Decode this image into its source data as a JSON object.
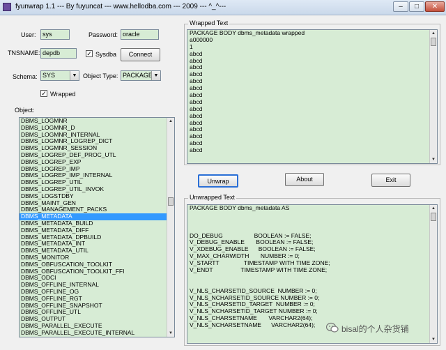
{
  "window": {
    "title": "fyunwrap 1.1 --- By fuyuncat --- www.hellodba.com --- 2009 --- ^_^---",
    "minimize": "–",
    "maximize": "□",
    "close": "✕"
  },
  "form": {
    "user_label": "User:",
    "user_value": "sys",
    "password_label": "Password:",
    "password_value": "oracle",
    "tnsname_label": "TNSNAME:",
    "tnsname_value": "depdb",
    "sysdba_label": "Sysdba",
    "sysdba_checked": "✓",
    "connect_label": "Connect",
    "schema_label": "Schema:",
    "schema_value": "SYS",
    "object_type_label": "Object Type:",
    "object_type_value": "PACKAGE B",
    "wrapped_label": "Wrapped",
    "wrapped_checked": "✓",
    "object_label": "Object:"
  },
  "objects": [
    "DBMS_LOGMNR",
    "DBMS_LOGMNR_D",
    "DBMS_LOGMNR_INTERNAL",
    "DBMS_LOGMNR_LOGREP_DICT",
    "DBMS_LOGMNR_SESSION",
    "DBMS_LOGREP_DEF_PROC_UTL",
    "DBMS_LOGREP_EXP",
    "DBMS_LOGREP_IMP",
    "DBMS_LOGREP_IMP_INTERNAL",
    "DBMS_LOGREP_UTIL",
    "DBMS_LOGREP_UTIL_INVOK",
    "DBMS_LOGSTDBY",
    "DBMS_MAINT_GEN",
    "DBMS_MANAGEMENT_PACKS",
    "DBMS_METADATA",
    "DBMS_METADATA_BUILD",
    "DBMS_METADATA_DIFF",
    "DBMS_METADATA_DPBUILD",
    "DBMS_METADATA_INT",
    "DBMS_METADATA_UTIL",
    "DBMS_MONITOR",
    "DBMS_OBFUSCATION_TOOLKIT",
    "DBMS_OBFUSCATION_TOOLKIT_FFI",
    "DBMS_ODCI",
    "DBMS_OFFLINE_INTERNAL",
    "DBMS_OFFLINE_OG",
    "DBMS_OFFLINE_RGT",
    "DBMS_OFFLINE_SNAPSHOT",
    "DBMS_OFFLINE_UTL",
    "DBMS_OUTPUT",
    "DBMS_PARALLEL_EXECUTE",
    "DBMS_PARALLEL_EXECUTE_INTERNAL"
  ],
  "selected_object": "DBMS_METADATA",
  "wrapped": {
    "title": "Wrapped Text",
    "lines": [
      "PACKAGE BODY dbms_metadata wrapped",
      "a000000",
      "1",
      "abcd",
      "abcd",
      "abcd",
      "abcd",
      "abcd",
      "abcd",
      "abcd",
      "abcd",
      "abcd",
      "abcd",
      "abcd",
      "abcd",
      "abcd",
      "abcd",
      "abcd"
    ]
  },
  "buttons": {
    "unwrap": "Unwrap",
    "about": "About",
    "exit": "Exit"
  },
  "unwrapped": {
    "title": "Unwrapped Text",
    "lines": [
      "PACKAGE BODY dbms_metadata AS",
      "",
      "",
      "",
      "DO_DEBUG                   BOOLEAN := FALSE;",
      "V_DEBUG_ENABLE       BOOLEAN := FALSE;",
      "V_XDEBUG_ENABLE      BOOLEAN := FALSE;",
      "V_MAX_CHARWIDTH       NUMBER := 0;",
      "V_STARTT               TIMESTAMP WITH TIME ZONE;",
      "V_ENDT                 TIMESTAMP WITH TIME ZONE;",
      "",
      "",
      "V_NLS_CHARSETID_SOURCE  NUMBER := 0;",
      "V_NLS_NCHARSETID_SOURCE NUMBER := 0;",
      "V_NLS_CHARSETID_TARGET  NUMBER := 0;",
      "V_NLS_NCHARSETID_TARGET NUMBER := 0;",
      "V_NLS_CHARSETNAME       VARCHAR2(64);",
      "V_NLS_NCHARSETNAME      VARCHAR2(64);"
    ]
  },
  "watermark": {
    "text": "bisal的个人杂货铺"
  },
  "colors": {
    "field_bg": "#d7ecd5",
    "selection": "#3399ff"
  }
}
